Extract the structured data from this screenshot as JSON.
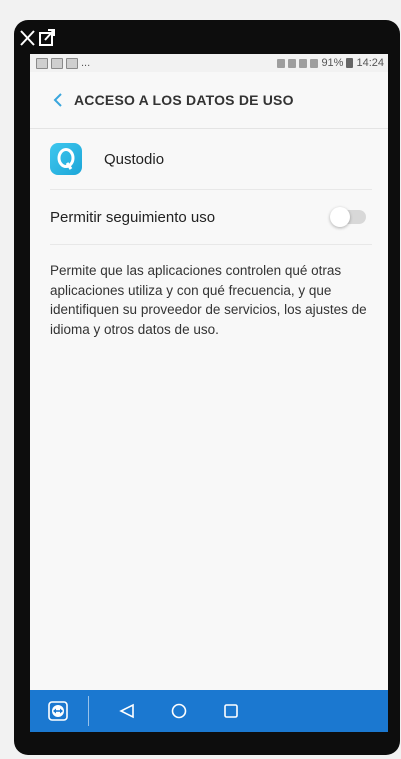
{
  "status_bar": {
    "notifications": "...",
    "battery": "91%",
    "time": "14:24"
  },
  "header": {
    "title": "ACCESO A LOS DATOS DE USO"
  },
  "app": {
    "name": "Qustodio",
    "icon_letter": "Q"
  },
  "permission": {
    "label": "Permitir seguimiento uso",
    "enabled": false
  },
  "description": "Permite que las aplicaciones controlen qué otras aplicaciones utiliza y con qué frecuencia, y que identifiquen su proveedor de servicios, los ajustes de idioma y otros datos de uso.",
  "colors": {
    "accent": "#3aa6dd",
    "navbar": "#1b78d0",
    "app_icon": "#2bb6e4"
  },
  "icons": [
    "close-icon",
    "popout-icon",
    "back-arrow-icon",
    "teamviewer-icon",
    "nav-back-icon",
    "nav-home-icon",
    "nav-recents-icon"
  ]
}
